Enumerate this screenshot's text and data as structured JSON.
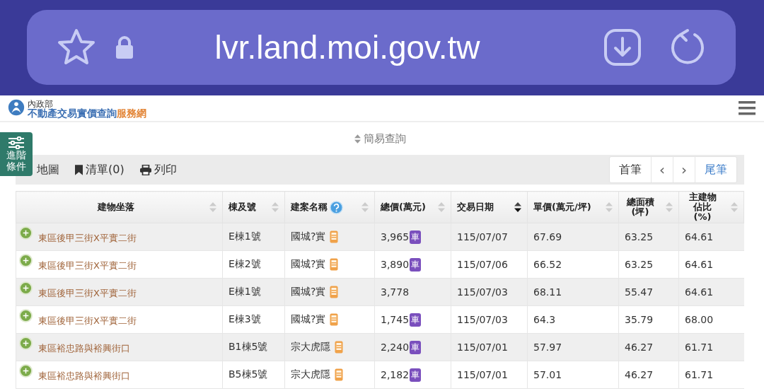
{
  "browser": {
    "url": "lvr.land.moi.gov.tw"
  },
  "header": {
    "ministry": "內政部",
    "title": "不動產交易實價查詢",
    "title_suffix": "服務網"
  },
  "advanced_button": {
    "label": "進階條件"
  },
  "query_toggle": {
    "label": "簡易查詢"
  },
  "toolbar": {
    "items": [
      {
        "kind": "map",
        "label": "地圖"
      },
      {
        "kind": "list",
        "label": "清單(0)"
      },
      {
        "kind": "print",
        "label": "列印"
      }
    ]
  },
  "pager": [
    {
      "label": "首筆",
      "kind": "text",
      "highlight": false
    },
    {
      "label": "‹",
      "kind": "arrow",
      "highlight": false
    },
    {
      "label": "›",
      "kind": "arrow",
      "highlight": false
    },
    {
      "label": "尾筆",
      "kind": "text",
      "highlight": true
    }
  ],
  "table": {
    "columns": [
      {
        "label": "建物坐落",
        "sorted": false
      },
      {
        "label": "棟及號",
        "sorted": false
      },
      {
        "label": "建案名稱",
        "sorted": false,
        "help": true
      },
      {
        "label": "總價(萬元)",
        "sorted": false
      },
      {
        "label": "交易日期",
        "sorted": true
      },
      {
        "label": "單價(萬元/坪)",
        "sorted": false
      },
      {
        "label": "總面積(坪)",
        "sorted": false
      },
      {
        "label": "主建物佔比(%)",
        "sorted": false
      }
    ],
    "rows": [
      {
        "address": "東區後甲三街X平實二街",
        "unit": "E棟1號",
        "project": "國城?實",
        "price": "3,965",
        "parking": "車",
        "date": "115/07/07",
        "unit_price": "67.69",
        "area": "63.25",
        "ratio": "64.61"
      },
      {
        "address": "東區後甲三街X平實二街",
        "unit": "E棟2號",
        "project": "國城?實",
        "price": "3,890",
        "parking": "車",
        "date": "115/07/06",
        "unit_price": "66.52",
        "area": "63.25",
        "ratio": "64.61"
      },
      {
        "address": "東區後甲三街X平實二街",
        "unit": "E棟1號",
        "project": "國城?實",
        "price": "3,778",
        "date": "115/07/03",
        "unit_price": "68.11",
        "area": "55.47",
        "ratio": "64.61"
      },
      {
        "address": "東區後甲三街X平實二街",
        "unit": "E棟3號",
        "project": "國城?實",
        "price": "1,745",
        "parking": "車",
        "date": "115/07/03",
        "unit_price": "64.3",
        "area": "35.79",
        "ratio": "68.00"
      },
      {
        "address": "東區裕忠路與裕興街口",
        "unit": "B1棟5號",
        "project": "宗大虎隱",
        "price": "2,240",
        "parking": "車",
        "date": "115/07/01",
        "unit_price": "57.97",
        "area": "46.27",
        "ratio": "61.71"
      },
      {
        "address": "東區裕忠路與裕興街口",
        "unit": "B5棟5號",
        "project": "宗大虎隱",
        "price": "2,182",
        "parking": "車",
        "date": "115/07/01",
        "unit_price": "57.01",
        "area": "46.27",
        "ratio": "61.71"
      }
    ]
  }
}
